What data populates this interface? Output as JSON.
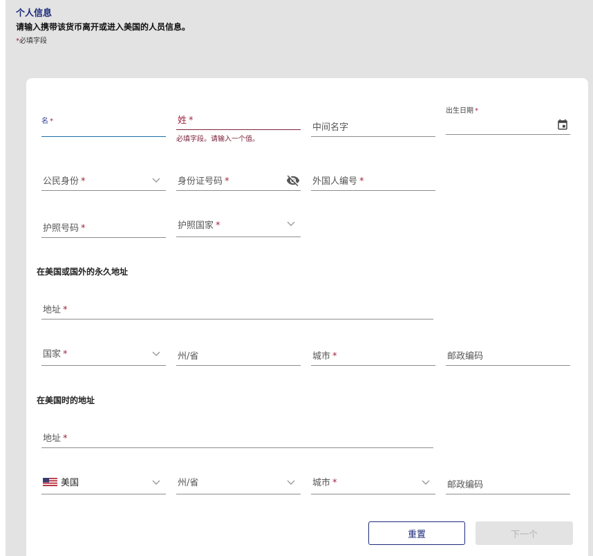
{
  "header": {
    "title": "个人信息",
    "subtitle": "请输入携带该货币离开或进入美国的人员信息。",
    "required_star": "*",
    "required_note": "必填字段"
  },
  "personal": {
    "first_name": {
      "label": "名",
      "star": "*",
      "value": ""
    },
    "last_name": {
      "label": "姓",
      "star": "*",
      "error": "必填字段。请输入一个值。"
    },
    "middle_name": {
      "label": "中间名字"
    },
    "dob": {
      "label": "出生日期",
      "star": "*",
      "icon": "calendar-icon"
    },
    "citizenship": {
      "label": "公民身份",
      "star": "*"
    },
    "id_number": {
      "label": "身份证号码",
      "star": "*",
      "icon": "eye-off-icon"
    },
    "alien_number": {
      "label": "外国人编号",
      "star": "*"
    },
    "passport_number": {
      "label": "护照号码",
      "star": "*"
    },
    "passport_country": {
      "label": "护照国家",
      "star": "*"
    }
  },
  "permanent_address": {
    "section_title": "在美国或国外的永久地址",
    "address": {
      "label": "地址",
      "star": "*"
    },
    "country": {
      "label": "国家",
      "star": "*"
    },
    "state": {
      "label": "州/省"
    },
    "city": {
      "label": "城市",
      "star": "*"
    },
    "postal": {
      "label": "邮政编码"
    }
  },
  "us_address": {
    "section_title": "在美国时的地址",
    "address": {
      "label": "地址",
      "star": "*"
    },
    "country": {
      "value": "美国",
      "flag": "us-flag"
    },
    "state": {
      "label": "州/省"
    },
    "city": {
      "label": "城市",
      "star": "*"
    },
    "postal": {
      "label": "邮政编码"
    }
  },
  "buttons": {
    "reset": "重置",
    "next": "下一个"
  },
  "colors": {
    "brand": "#1b2a7a",
    "error": "#a0233c",
    "focus": "#1a6fa5",
    "background": "#e3e3e3"
  }
}
